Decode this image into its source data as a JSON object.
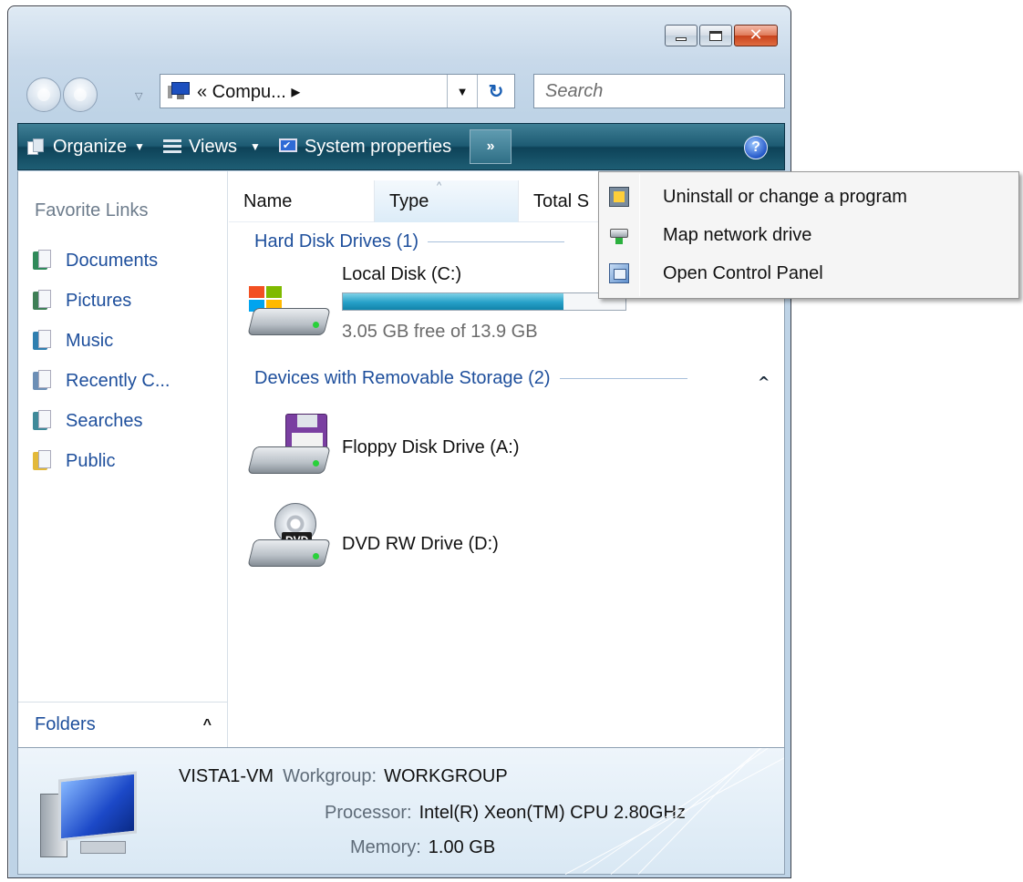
{
  "address_bar": {
    "path": "« Compu... ▸",
    "search_placeholder": "Search"
  },
  "command_bar": {
    "organize": "Organize",
    "views": "Views",
    "system_properties": "System properties",
    "more": "»",
    "help": "?"
  },
  "nav_pane": {
    "title": "Favorite Links",
    "items": [
      {
        "label": "Documents",
        "icon": "documents-icon",
        "color": "#2f8a5a"
      },
      {
        "label": "Pictures",
        "icon": "pictures-icon",
        "color": "#3e7f56"
      },
      {
        "label": "Music",
        "icon": "music-icon",
        "color": "#2f7fb0"
      },
      {
        "label": "Recently C...",
        "icon": "recent-icon",
        "color": "#6c8fb6"
      },
      {
        "label": "Searches",
        "icon": "searches-icon",
        "color": "#3f8a9a"
      },
      {
        "label": "Public",
        "icon": "public-folder-icon",
        "color": "#e3b93a"
      }
    ],
    "folders_label": "Folders"
  },
  "columns": [
    "Name",
    "Type",
    "Total S"
  ],
  "groups": {
    "hard_disks": {
      "title": "Hard Disk Drives (1)",
      "drives": [
        {
          "name": "Local Disk (C:)",
          "free_text": "3.05 GB free of 13.9 GB",
          "used_fraction": 0.78
        }
      ]
    },
    "removable": {
      "title": "Devices with Removable Storage (2)",
      "drives": [
        {
          "name": "Floppy Disk Drive (A:)"
        },
        {
          "name": "DVD RW Drive (D:)",
          "badge": "DVD"
        }
      ]
    }
  },
  "details": {
    "computer_name": "VISTA1-VM",
    "workgroup_label": "Workgroup:",
    "workgroup_value": "WORKGROUP",
    "processor_label": "Processor:",
    "processor_value": "Intel(R) Xeon(TM) CPU 2.80GHz",
    "memory_label": "Memory:",
    "memory_value": "1.00 GB"
  },
  "popup_menu": {
    "items": [
      {
        "label": "Uninstall or change a program",
        "icon": "uninstall-program-icon"
      },
      {
        "label": "Map network drive",
        "icon": "map-network-drive-icon"
      },
      {
        "label": "Open Control Panel",
        "icon": "control-panel-icon"
      }
    ]
  },
  "colors": {
    "command_bar": "#1d5b73",
    "link_text": "#1e4f9c",
    "capacity_fill": "#26a0c8"
  }
}
